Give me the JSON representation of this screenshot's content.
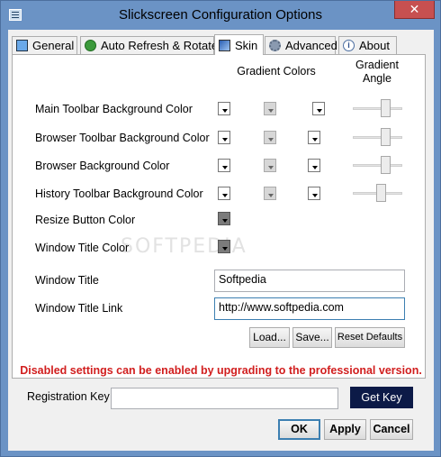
{
  "window": {
    "title": "Slickscreen Configuration Options",
    "close_glyph": "✕"
  },
  "tabs": [
    {
      "label": "General",
      "icon": "general-icon"
    },
    {
      "label": "Auto Refresh & Rotate",
      "icon": "refresh-icon"
    },
    {
      "label": "Skin",
      "icon": "skin-icon",
      "active": true
    },
    {
      "label": "Advanced",
      "icon": "gear-icon"
    },
    {
      "label": "About",
      "icon": "info-icon"
    }
  ],
  "skin": {
    "gradient_colors_header": "Gradient Colors",
    "gradient_angle_header": "Gradient\nAngle",
    "rows": [
      {
        "label": "Main Toolbar Background Color",
        "angle": 0.7
      },
      {
        "label": "Browser Toolbar Background Color",
        "angle": 0.7
      },
      {
        "label": "Browser Background Color",
        "angle": 0.7
      },
      {
        "label": "History Toolbar Background Color",
        "angle": 0.6
      }
    ],
    "resize_button_color_label": "Resize Button Color",
    "window_title_color_label": "Window Title Color",
    "window_title_label": "Window Title",
    "window_title_value": "Softpedia",
    "window_title_link_label": "Window Title Link",
    "window_title_link_value": "http://www.softpedia.com",
    "load_button": "Load...",
    "save_button": "Save...",
    "reset_button": "Reset Defaults",
    "watermark": "SOFTPEDIA"
  },
  "notice": "Disabled settings can be enabled by upgrading to the professional version.",
  "registration": {
    "label": "Registration Key",
    "value": "",
    "get_key_button": "Get Key"
  },
  "footer": {
    "ok_button": "OK",
    "apply_button": "Apply",
    "cancel_button": "Cancel"
  },
  "colors": {
    "title_bar": "#6b93c5",
    "close_button": "#c75050",
    "notice": "#d11e1e",
    "get_key_bg": "#0c1a47"
  }
}
